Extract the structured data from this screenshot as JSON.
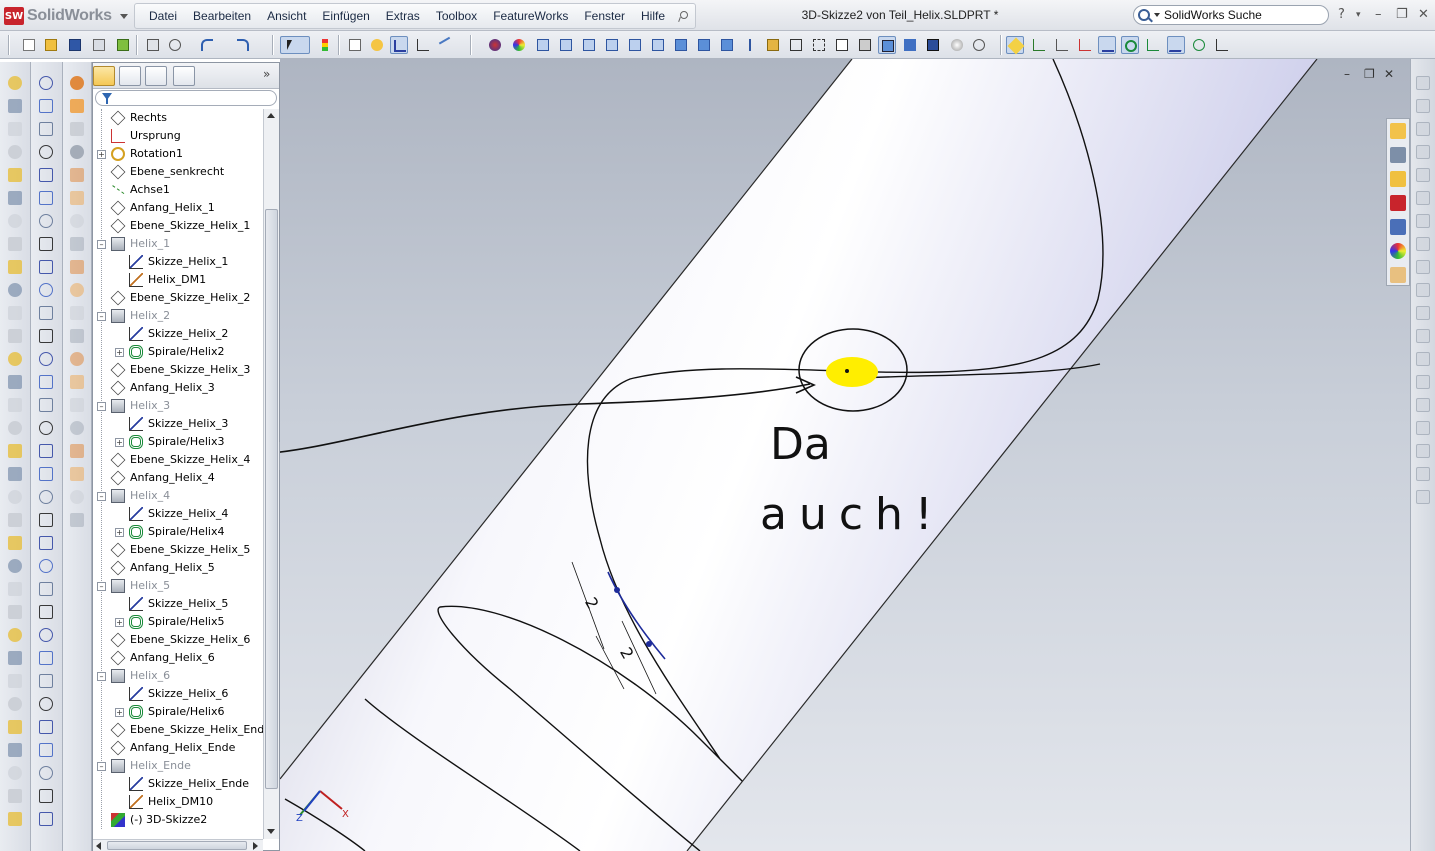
{
  "app": {
    "name": "SolidWorks",
    "document_title": "3D-Skizze2 von Teil_Helix.SLDPRT *"
  },
  "menu": [
    "Datei",
    "Bearbeiten",
    "Ansicht",
    "Einfügen",
    "Extras",
    "Toolbox",
    "FeatureWorks",
    "Fenster",
    "Hilfe"
  ],
  "search": {
    "placeholder": "SolidWorks Suche"
  },
  "window_controls": {
    "help": "?",
    "minimize": "–",
    "restore": "❐",
    "close": "✕"
  },
  "feature_tree": {
    "items": [
      {
        "label": "Rechts",
        "icon": "plane-icon",
        "level": 0,
        "expander": "",
        "dim": false
      },
      {
        "label": "Ursprung",
        "icon": "origin-icon",
        "level": 0,
        "expander": "",
        "dim": false
      },
      {
        "label": "Rotation1",
        "icon": "revolve-icon",
        "level": 0,
        "expander": "+",
        "dim": false
      },
      {
        "label": "Ebene_senkrecht",
        "icon": "plane-icon",
        "level": 0,
        "expander": "",
        "dim": false
      },
      {
        "label": "Achse1",
        "icon": "axis-icon",
        "level": 0,
        "expander": "",
        "dim": false
      },
      {
        "label": "Anfang_Helix_1",
        "icon": "plane-icon",
        "level": 0,
        "expander": "",
        "dim": false
      },
      {
        "label": "Ebene_Skizze_Helix_1",
        "icon": "plane-icon",
        "level": 0,
        "expander": "",
        "dim": false
      },
      {
        "label": "Helix_1",
        "icon": "folder-icon",
        "level": 0,
        "expander": "–",
        "dim": true
      },
      {
        "label": "Skizze_Helix_1",
        "icon": "sketch-icon",
        "level": 1,
        "expander": "",
        "dim": false
      },
      {
        "label": "Helix_DM1",
        "icon": "derived-sketch-icon",
        "level": 1,
        "expander": "",
        "dim": false
      },
      {
        "label": "Ebene_Skizze_Helix_2",
        "icon": "plane-icon",
        "level": 0,
        "expander": "",
        "dim": false
      },
      {
        "label": "Helix_2",
        "icon": "folder-icon",
        "level": 0,
        "expander": "–",
        "dim": true
      },
      {
        "label": "Skizze_Helix_2",
        "icon": "sketch-icon",
        "level": 1,
        "expander": "",
        "dim": false
      },
      {
        "label": "Spirale/Helix2",
        "icon": "helix-icon",
        "level": 1,
        "expander": "+",
        "dim": false
      },
      {
        "label": "Ebene_Skizze_Helix_3",
        "icon": "plane-icon",
        "level": 0,
        "expander": "",
        "dim": false
      },
      {
        "label": "Anfang_Helix_3",
        "icon": "plane-icon",
        "level": 0,
        "expander": "",
        "dim": false
      },
      {
        "label": "Helix_3",
        "icon": "folder-icon",
        "level": 0,
        "expander": "–",
        "dim": true
      },
      {
        "label": "Skizze_Helix_3",
        "icon": "sketch-icon",
        "level": 1,
        "expander": "",
        "dim": false
      },
      {
        "label": "Spirale/Helix3",
        "icon": "helix-icon",
        "level": 1,
        "expander": "+",
        "dim": false
      },
      {
        "label": "Ebene_Skizze_Helix_4",
        "icon": "plane-icon",
        "level": 0,
        "expander": "",
        "dim": false
      },
      {
        "label": "Anfang_Helix_4",
        "icon": "plane-icon",
        "level": 0,
        "expander": "",
        "dim": false
      },
      {
        "label": "Helix_4",
        "icon": "folder-icon",
        "level": 0,
        "expander": "–",
        "dim": true
      },
      {
        "label": "Skizze_Helix_4",
        "icon": "sketch-icon",
        "level": 1,
        "expander": "",
        "dim": false
      },
      {
        "label": "Spirale/Helix4",
        "icon": "helix-icon",
        "level": 1,
        "expander": "+",
        "dim": false
      },
      {
        "label": "Ebene_Skizze_Helix_5",
        "icon": "plane-icon",
        "level": 0,
        "expander": "",
        "dim": false
      },
      {
        "label": "Anfang_Helix_5",
        "icon": "plane-icon",
        "level": 0,
        "expander": "",
        "dim": false
      },
      {
        "label": "Helix_5",
        "icon": "folder-icon",
        "level": 0,
        "expander": "–",
        "dim": true
      },
      {
        "label": "Skizze_Helix_5",
        "icon": "sketch-icon",
        "level": 1,
        "expander": "",
        "dim": false
      },
      {
        "label": "Spirale/Helix5",
        "icon": "helix-icon",
        "level": 1,
        "expander": "+",
        "dim": false
      },
      {
        "label": "Ebene_Skizze_Helix_6",
        "icon": "plane-icon",
        "level": 0,
        "expander": "",
        "dim": false
      },
      {
        "label": "Anfang_Helix_6",
        "icon": "plane-icon",
        "level": 0,
        "expander": "",
        "dim": false
      },
      {
        "label": "Helix_6",
        "icon": "folder-icon",
        "level": 0,
        "expander": "–",
        "dim": true
      },
      {
        "label": "Skizze_Helix_6",
        "icon": "sketch-icon",
        "level": 1,
        "expander": "",
        "dim": false
      },
      {
        "label": "Spirale/Helix6",
        "icon": "helix-icon",
        "level": 1,
        "expander": "+",
        "dim": false
      },
      {
        "label": "Ebene_Skizze_Helix_Ende",
        "icon": "plane-icon",
        "level": 0,
        "expander": "",
        "dim": false
      },
      {
        "label": "Anfang_Helix_Ende",
        "icon": "plane-icon",
        "level": 0,
        "expander": "",
        "dim": false
      },
      {
        "label": "Helix_Ende",
        "icon": "folder-icon",
        "level": 0,
        "expander": "–",
        "dim": true
      },
      {
        "label": "Skizze_Helix_Ende",
        "icon": "sketch-icon",
        "level": 1,
        "expander": "",
        "dim": false
      },
      {
        "label": "Helix_DM10",
        "icon": "derived-sketch-icon",
        "level": 1,
        "expander": "",
        "dim": false
      },
      {
        "label": "(-) 3D-Skizze2",
        "icon": "3d-sketch-icon",
        "level": 0,
        "expander": "",
        "dim": false
      }
    ]
  },
  "viewport": {
    "annotation_line1": "Da",
    "annotation_line2": "auch!",
    "dimension_1": "2",
    "dimension_2": "2",
    "triad_x": "X",
    "triad_z": "Z",
    "highlight_color": "#ffee00"
  },
  "colors": {
    "brand": "#c8242c",
    "sketch_blue": "#1d2b9a",
    "accent_yellow": "#ffee00"
  }
}
